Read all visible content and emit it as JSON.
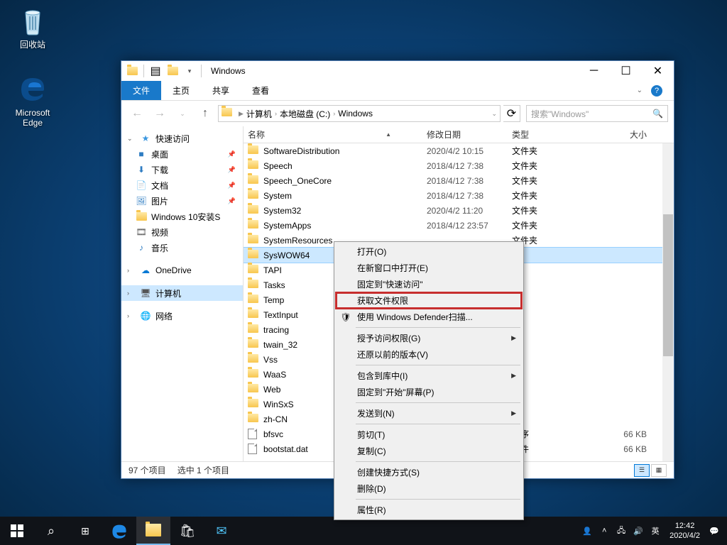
{
  "desktop": {
    "recyclebin": "回收站",
    "edge": "Microsoft Edge"
  },
  "window": {
    "title": "Windows",
    "tabs": {
      "file": "文件",
      "home": "主页",
      "share": "共享",
      "view": "查看"
    },
    "breadcrumb": {
      "computer": "计算机",
      "drive": "本地磁盘 (C:)",
      "folder": "Windows"
    },
    "search_placeholder": "搜索\"Windows\"",
    "columns": {
      "name": "名称",
      "date": "修改日期",
      "type": "类型",
      "size": "大小"
    },
    "status": {
      "count": "97 个项目",
      "selected": "选中 1 个项目"
    }
  },
  "nav": {
    "quick": "快速访问",
    "desktop": "桌面",
    "downloads": "下载",
    "documents": "文档",
    "pictures": "图片",
    "win10inst": "Windows 10安装S",
    "videos": "视频",
    "music": "音乐",
    "onedrive": "OneDrive",
    "computer": "计算机",
    "network": "网络"
  },
  "files": [
    {
      "n": "SoftwareDistribution",
      "d": "2020/4/2 10:15",
      "t": "文件夹",
      "k": "folder"
    },
    {
      "n": "Speech",
      "d": "2018/4/12 7:38",
      "t": "文件夹",
      "k": "folder"
    },
    {
      "n": "Speech_OneCore",
      "d": "2018/4/12 7:38",
      "t": "文件夹",
      "k": "folder"
    },
    {
      "n": "System",
      "d": "2018/4/12 7:38",
      "t": "文件夹",
      "k": "folder"
    },
    {
      "n": "System32",
      "d": "2020/4/2 11:20",
      "t": "文件夹",
      "k": "folder"
    },
    {
      "n": "SystemApps",
      "d": "2018/4/12 23:57",
      "t": "文件夹",
      "k": "folder"
    },
    {
      "n": "SystemResources",
      "d": "",
      "t": "文件夹",
      "k": "folder"
    },
    {
      "n": "SysWOW64",
      "d": "",
      "t": "夹",
      "k": "folder",
      "sel": true
    },
    {
      "n": "TAPI",
      "d": "",
      "t": "夹",
      "k": "folder"
    },
    {
      "n": "Tasks",
      "d": "",
      "t": "夹",
      "k": "folder"
    },
    {
      "n": "Temp",
      "d": "",
      "t": "夹",
      "k": "folder"
    },
    {
      "n": "TextInput",
      "d": "",
      "t": "夹",
      "k": "folder"
    },
    {
      "n": "tracing",
      "d": "",
      "t": "夹",
      "k": "folder"
    },
    {
      "n": "twain_32",
      "d": "",
      "t": "夹",
      "k": "folder"
    },
    {
      "n": "Vss",
      "d": "",
      "t": "夹",
      "k": "folder"
    },
    {
      "n": "WaaS",
      "d": "",
      "t": "夹",
      "k": "folder"
    },
    {
      "n": "Web",
      "d": "",
      "t": "夹",
      "k": "folder"
    },
    {
      "n": "WinSxS",
      "d": "",
      "t": "夹",
      "k": "folder"
    },
    {
      "n": "zh-CN",
      "d": "",
      "t": "夹",
      "k": "folder"
    },
    {
      "n": "bfsvc",
      "d": "",
      "t": "程序",
      "k": "file",
      "s": "66 KB"
    },
    {
      "n": "bootstat.dat",
      "d": "",
      "t": "文件",
      "k": "file",
      "s": "66 KB"
    }
  ],
  "ctx": {
    "open": "打开(O)",
    "newwin": "在新窗口中打开(E)",
    "pinquick": "固定到\"快速访问\"",
    "getperm": "获取文件权限",
    "defender": "使用 Windows Defender扫描...",
    "grantaccess": "授予访问权限(G)",
    "restore": "还原以前的版本(V)",
    "include": "包含到库中(I)",
    "pinstart": "固定到\"开始\"屏幕(P)",
    "sendto": "发送到(N)",
    "cut": "剪切(T)",
    "copy": "复制(C)",
    "shortcut": "创建快捷方式(S)",
    "delete": "删除(D)",
    "properties": "属性(R)"
  },
  "tray": {
    "ime": "英",
    "time": "12:42",
    "date": "2020/4/2"
  }
}
